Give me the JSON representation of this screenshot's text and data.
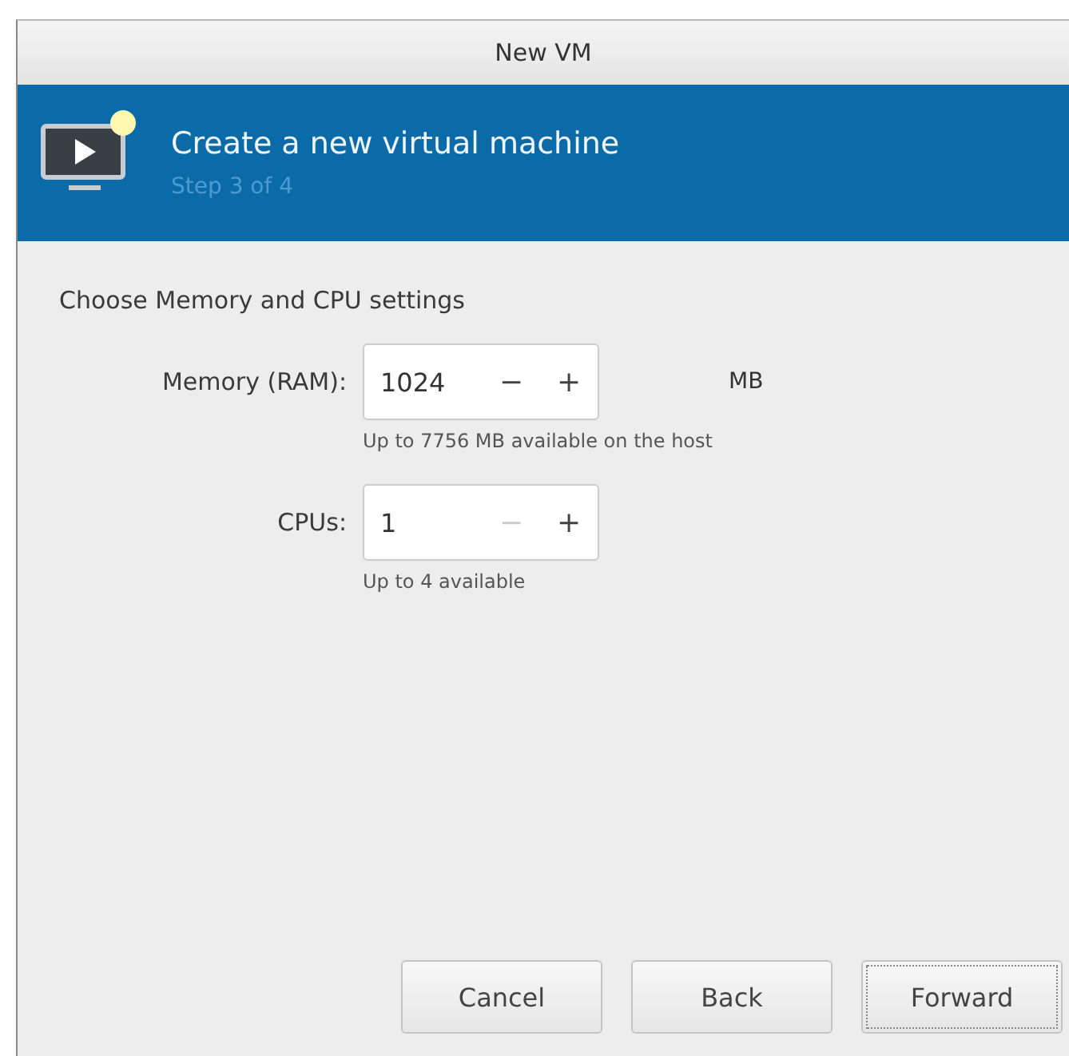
{
  "window": {
    "title": "New VM"
  },
  "banner": {
    "title": "Create a new virtual machine",
    "step": "Step 3 of 4"
  },
  "section_title": "Choose Memory and CPU settings",
  "settings": [
    {
      "label": "Memory (RAM):",
      "value": "1024",
      "minus": "−",
      "plus": "+",
      "minus_disabled": false,
      "plus_disabled": false,
      "unit": "MB",
      "hint": "Up to 7756 MB available on the host"
    },
    {
      "label": "CPUs:",
      "value": "1",
      "minus": "−",
      "plus": "+",
      "minus_disabled": true,
      "plus_disabled": false,
      "hint": "Up to 4 available"
    }
  ],
  "buttons": [
    {
      "label": "Cancel",
      "focused": false
    },
    {
      "label": "Back",
      "focused": false
    },
    {
      "label": "Forward",
      "focused": true
    }
  ]
}
